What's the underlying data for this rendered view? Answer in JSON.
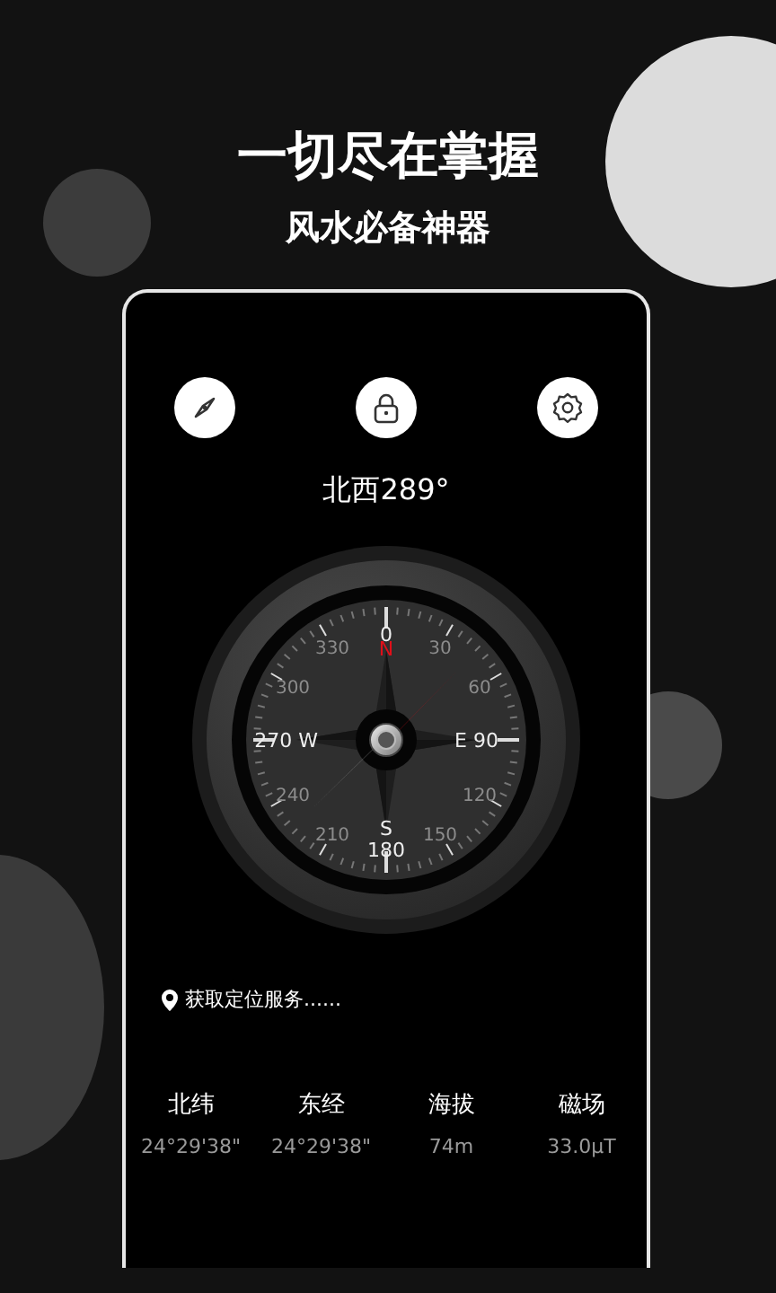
{
  "headline": "一切尽在掌握",
  "subheadline": "风水必备神器",
  "toolbar": [
    {
      "kind": "compass"
    },
    {
      "kind": "lock"
    },
    {
      "kind": "settings"
    }
  ],
  "heading": "北西289°",
  "dial": {
    "numbers": [
      "0",
      "330",
      "30",
      "300",
      "60",
      "270 W",
      "E 90",
      "240",
      "120",
      "210",
      "150",
      "180"
    ],
    "north": "N",
    "south": "S"
  },
  "location": "获取定位服务......",
  "stats": [
    {
      "label": "北纬",
      "value": "24°29'38\""
    },
    {
      "label": "东经",
      "value": "24°29'38\""
    },
    {
      "label": "海拔",
      "value": "74m"
    },
    {
      "label": "磁场",
      "value": "33.0µT"
    }
  ]
}
